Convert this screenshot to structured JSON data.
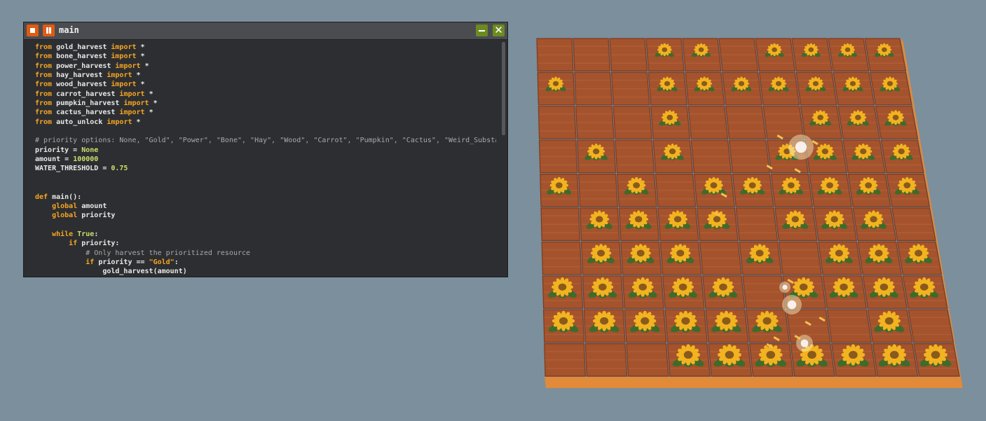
{
  "editor": {
    "title": "main",
    "stop_icon": "stop-icon",
    "pause_icon": "pause-icon",
    "minimize_icon": "minimize-icon",
    "close_icon": "close-icon",
    "close_glyph": "✕",
    "lines": [
      [
        {
          "t": "from ",
          "c": "kw"
        },
        {
          "t": "gold_harvest "
        },
        {
          "t": "import ",
          "c": "kw"
        },
        {
          "t": "*"
        }
      ],
      [
        {
          "t": "from ",
          "c": "kw"
        },
        {
          "t": "bone_harvest "
        },
        {
          "t": "import ",
          "c": "kw"
        },
        {
          "t": "*"
        }
      ],
      [
        {
          "t": "from ",
          "c": "kw"
        },
        {
          "t": "power_harvest "
        },
        {
          "t": "import ",
          "c": "kw"
        },
        {
          "t": "*"
        }
      ],
      [
        {
          "t": "from ",
          "c": "kw"
        },
        {
          "t": "hay_harvest "
        },
        {
          "t": "import ",
          "c": "kw"
        },
        {
          "t": "*"
        }
      ],
      [
        {
          "t": "from ",
          "c": "kw"
        },
        {
          "t": "wood_harvest "
        },
        {
          "t": "import ",
          "c": "kw"
        },
        {
          "t": "*"
        }
      ],
      [
        {
          "t": "from ",
          "c": "kw"
        },
        {
          "t": "carrot_harvest "
        },
        {
          "t": "import ",
          "c": "kw"
        },
        {
          "t": "*"
        }
      ],
      [
        {
          "t": "from ",
          "c": "kw"
        },
        {
          "t": "pumpkin_harvest "
        },
        {
          "t": "import ",
          "c": "kw"
        },
        {
          "t": "*"
        }
      ],
      [
        {
          "t": "from ",
          "c": "kw"
        },
        {
          "t": "cactus_harvest "
        },
        {
          "t": "import ",
          "c": "kw"
        },
        {
          "t": "*"
        }
      ],
      [
        {
          "t": "from ",
          "c": "kw"
        },
        {
          "t": "auto_unlock "
        },
        {
          "t": "import ",
          "c": "kw"
        },
        {
          "t": "*"
        }
      ],
      [],
      [
        {
          "t": "# priority options: None, \"Gold\", \"Power\", \"Bone\", \"Hay\", \"Wood\", \"Carrot\", \"Pumpkin\", \"Cactus\", \"Weird_Substance\"",
          "c": "cm"
        }
      ],
      [
        {
          "t": "priority = "
        },
        {
          "t": "None",
          "c": "cst"
        }
      ],
      [
        {
          "t": "amount = "
        },
        {
          "t": "100000",
          "c": "num"
        }
      ],
      [
        {
          "t": "WATER_THRESHOLD = "
        },
        {
          "t": "0.75",
          "c": "num"
        }
      ],
      [],
      [],
      [
        {
          "t": "def ",
          "c": "kw"
        },
        {
          "t": "main():"
        }
      ],
      [
        {
          "t": "    "
        },
        {
          "t": "global ",
          "c": "kw"
        },
        {
          "t": "amount"
        }
      ],
      [
        {
          "t": "    "
        },
        {
          "t": "global ",
          "c": "kw"
        },
        {
          "t": "priority"
        }
      ],
      [],
      [
        {
          "t": "    "
        },
        {
          "t": "while ",
          "c": "kw"
        },
        {
          "t": "True",
          "c": "cst"
        },
        {
          "t": ":"
        }
      ],
      [
        {
          "t": "        "
        },
        {
          "t": "if ",
          "c": "kw"
        },
        {
          "t": "priority:"
        }
      ],
      [
        {
          "t": "            "
        },
        {
          "t": "# Only harvest the prioritized resource",
          "c": "cm"
        }
      ],
      [
        {
          "t": "            "
        },
        {
          "t": "if ",
          "c": "kw"
        },
        {
          "t": "priority == "
        },
        {
          "t": "\"Gold\"",
          "c": "str"
        },
        {
          "t": ":"
        }
      ],
      [
        {
          "t": "                gold_harvest(amount)"
        }
      ]
    ]
  },
  "farm": {
    "rows": 10,
    "cols": 10,
    "tile_color": "#a4532d",
    "plank_color": "#b4623a",
    "edge_color": "#e08a3a",
    "flower_petal_color": "#f2b320",
    "flower_center_color": "#8a5a1c",
    "leaf_color": "#3f6b2a",
    "crop": "sunflower",
    "sunflowers": [
      [
        0,
        3
      ],
      [
        0,
        4
      ],
      [
        0,
        6
      ],
      [
        0,
        7
      ],
      [
        0,
        8
      ],
      [
        0,
        9
      ],
      [
        1,
        0
      ],
      [
        1,
        3
      ],
      [
        1,
        4
      ],
      [
        1,
        5
      ],
      [
        1,
        6
      ],
      [
        1,
        7
      ],
      [
        1,
        8
      ],
      [
        1,
        9
      ],
      [
        2,
        3
      ],
      [
        2,
        7
      ],
      [
        2,
        8
      ],
      [
        2,
        9
      ],
      [
        3,
        1
      ],
      [
        3,
        3
      ],
      [
        3,
        6
      ],
      [
        3,
        7
      ],
      [
        3,
        8
      ],
      [
        3,
        9
      ],
      [
        4,
        0
      ],
      [
        4,
        2
      ],
      [
        4,
        4
      ],
      [
        4,
        5
      ],
      [
        4,
        6
      ],
      [
        4,
        7
      ],
      [
        4,
        8
      ],
      [
        4,
        9
      ],
      [
        5,
        1
      ],
      [
        5,
        2
      ],
      [
        5,
        3
      ],
      [
        5,
        4
      ],
      [
        5,
        6
      ],
      [
        5,
        7
      ],
      [
        5,
        8
      ],
      [
        6,
        1
      ],
      [
        6,
        2
      ],
      [
        6,
        3
      ],
      [
        6,
        5
      ],
      [
        6,
        7
      ],
      [
        6,
        8
      ],
      [
        6,
        9
      ],
      [
        7,
        0
      ],
      [
        7,
        1
      ],
      [
        7,
        2
      ],
      [
        7,
        3
      ],
      [
        7,
        4
      ],
      [
        7,
        6
      ],
      [
        7,
        7
      ],
      [
        7,
        8
      ],
      [
        7,
        9
      ],
      [
        8,
        0
      ],
      [
        8,
        1
      ],
      [
        8,
        2
      ],
      [
        8,
        3
      ],
      [
        8,
        4
      ],
      [
        8,
        5
      ],
      [
        8,
        8
      ],
      [
        9,
        3
      ],
      [
        9,
        4
      ],
      [
        9,
        5
      ],
      [
        9,
        6
      ],
      [
        9,
        7
      ],
      [
        9,
        8
      ],
      [
        9,
        9
      ]
    ],
    "sparkle_icon": "harvest-sparkle-icon"
  }
}
